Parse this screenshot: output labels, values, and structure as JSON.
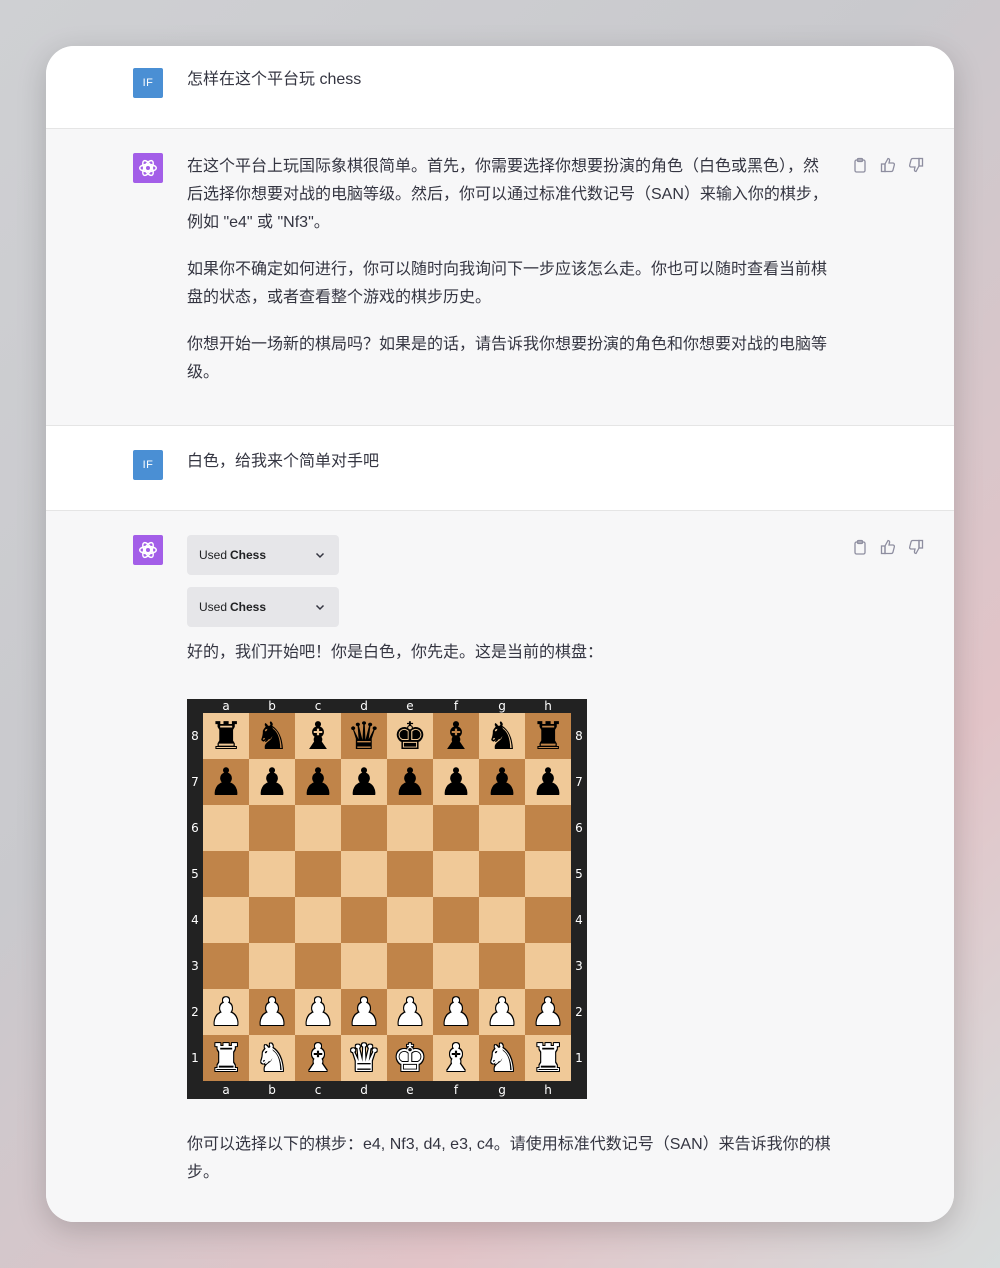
{
  "conversation": {
    "turn1": {
      "avatar_label": "IF",
      "text": "怎样在这个平台玩 chess"
    },
    "turn2": {
      "paragraphs": [
        "在这个平台上玩国际象棋很简单。首先，你需要选择你想要扮演的角色（白色或黑色），然后选择你想要对战的电脑等级。然后，你可以通过标准代数记号（SAN）来输入你的棋步，例如 \"e4\" 或 \"Nf3\"。",
        "如果你不确定如何进行，你可以随时向我询问下一步应该怎么走。你也可以随时查看当前棋盘的状态，或者查看整个游戏的棋步历史。",
        "你想开始一场新的棋局吗？如果是的话，请告诉我你想要扮演的角色和你想要对战的电脑等级。"
      ],
      "icons": [
        "clipboard-icon",
        "thumbs-up-icon",
        "thumbs-down-icon"
      ]
    },
    "turn3": {
      "avatar_label": "IF",
      "text": "白色，给我来个简单对手吧"
    },
    "turn4": {
      "tools": [
        {
          "used": "Used",
          "name": "Chess"
        },
        {
          "used": "Used",
          "name": "Chess"
        }
      ],
      "intro": "好的，我们开始吧！你是白色，你先走。这是当前的棋盘：",
      "outro": "你可以选择以下的棋步：e4, Nf3, d4, e3, c4。请使用标准代数记号（SAN）来告诉我你的棋步。"
    }
  },
  "board": {
    "files": [
      "a",
      "b",
      "c",
      "d",
      "e",
      "f",
      "g",
      "h"
    ],
    "ranks": [
      "8",
      "7",
      "6",
      "5",
      "4",
      "3",
      "2",
      "1"
    ],
    "rows": [
      [
        "r",
        "n",
        "b",
        "q",
        "k",
        "b",
        "n",
        "r"
      ],
      [
        "p",
        "p",
        "p",
        "p",
        "p",
        "p",
        "p",
        "p"
      ],
      [
        "",
        "",
        "",
        "",
        "",
        "",
        "",
        ""
      ],
      [
        "",
        "",
        "",
        "",
        "",
        "",
        "",
        ""
      ],
      [
        "",
        "",
        "",
        "",
        "",
        "",
        "",
        ""
      ],
      [
        "",
        "",
        "",
        "",
        "",
        "",
        "",
        ""
      ],
      [
        "P",
        "P",
        "P",
        "P",
        "P",
        "P",
        "P",
        "P"
      ],
      [
        "R",
        "N",
        "B",
        "Q",
        "K",
        "B",
        "N",
        "R"
      ]
    ],
    "colors": {
      "light": "#f0c998",
      "dark": "#c08449",
      "frame": "#222222"
    }
  },
  "colors": {
    "user_avatar": "#4a8fd4",
    "assistant_avatar": "#a35ee8",
    "user_bg": "#ffffff",
    "assistant_bg": "#f7f7f8"
  }
}
